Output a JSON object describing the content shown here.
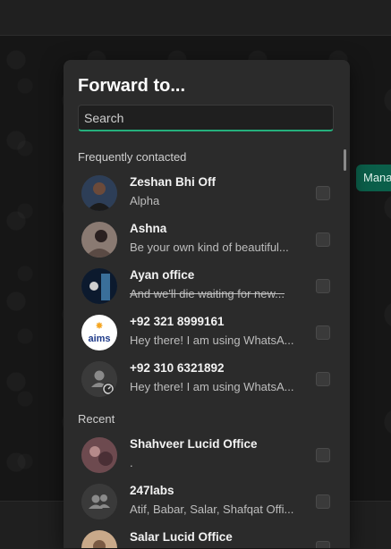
{
  "dialog": {
    "title": "Forward to...",
    "search_placeholder": "Search"
  },
  "side_button": {
    "label": "Mana"
  },
  "sections": {
    "frequent": "Frequently contacted",
    "recent": "Recent"
  },
  "frequent_contacts": [
    {
      "name": "Zeshan Bhi Off",
      "status": "Alpha",
      "avatar": "photo-avatar"
    },
    {
      "name": "Ashna",
      "status": "Be your own kind of beautiful...",
      "avatar": "photo-avatar"
    },
    {
      "name": "Ayan office",
      "status": "And we'll die waiting for new...",
      "avatar": "photo-avatar"
    },
    {
      "name": "+92 321 8999161",
      "status": "Hey there! I am using WhatsA...",
      "avatar": "aims-logo-avatar"
    },
    {
      "name": "+92 310 6321892",
      "status": "Hey there! I am using WhatsA...",
      "avatar": "default-person-avatar"
    }
  ],
  "recent_contacts": [
    {
      "name": "Shahveer Lucid Office",
      "status": ".",
      "avatar": "photo-avatar"
    },
    {
      "name": "247labs",
      "status": "Atif, Babar, Salar, Shafqat Offi...",
      "avatar": "group-avatar"
    },
    {
      "name": "Salar Lucid Office",
      "status": "",
      "avatar": "photo-avatar"
    }
  ],
  "colors": {
    "accent": "#25b07d",
    "dialog_bg": "#2b2b2b",
    "manage_button": "#0b5f4a"
  }
}
